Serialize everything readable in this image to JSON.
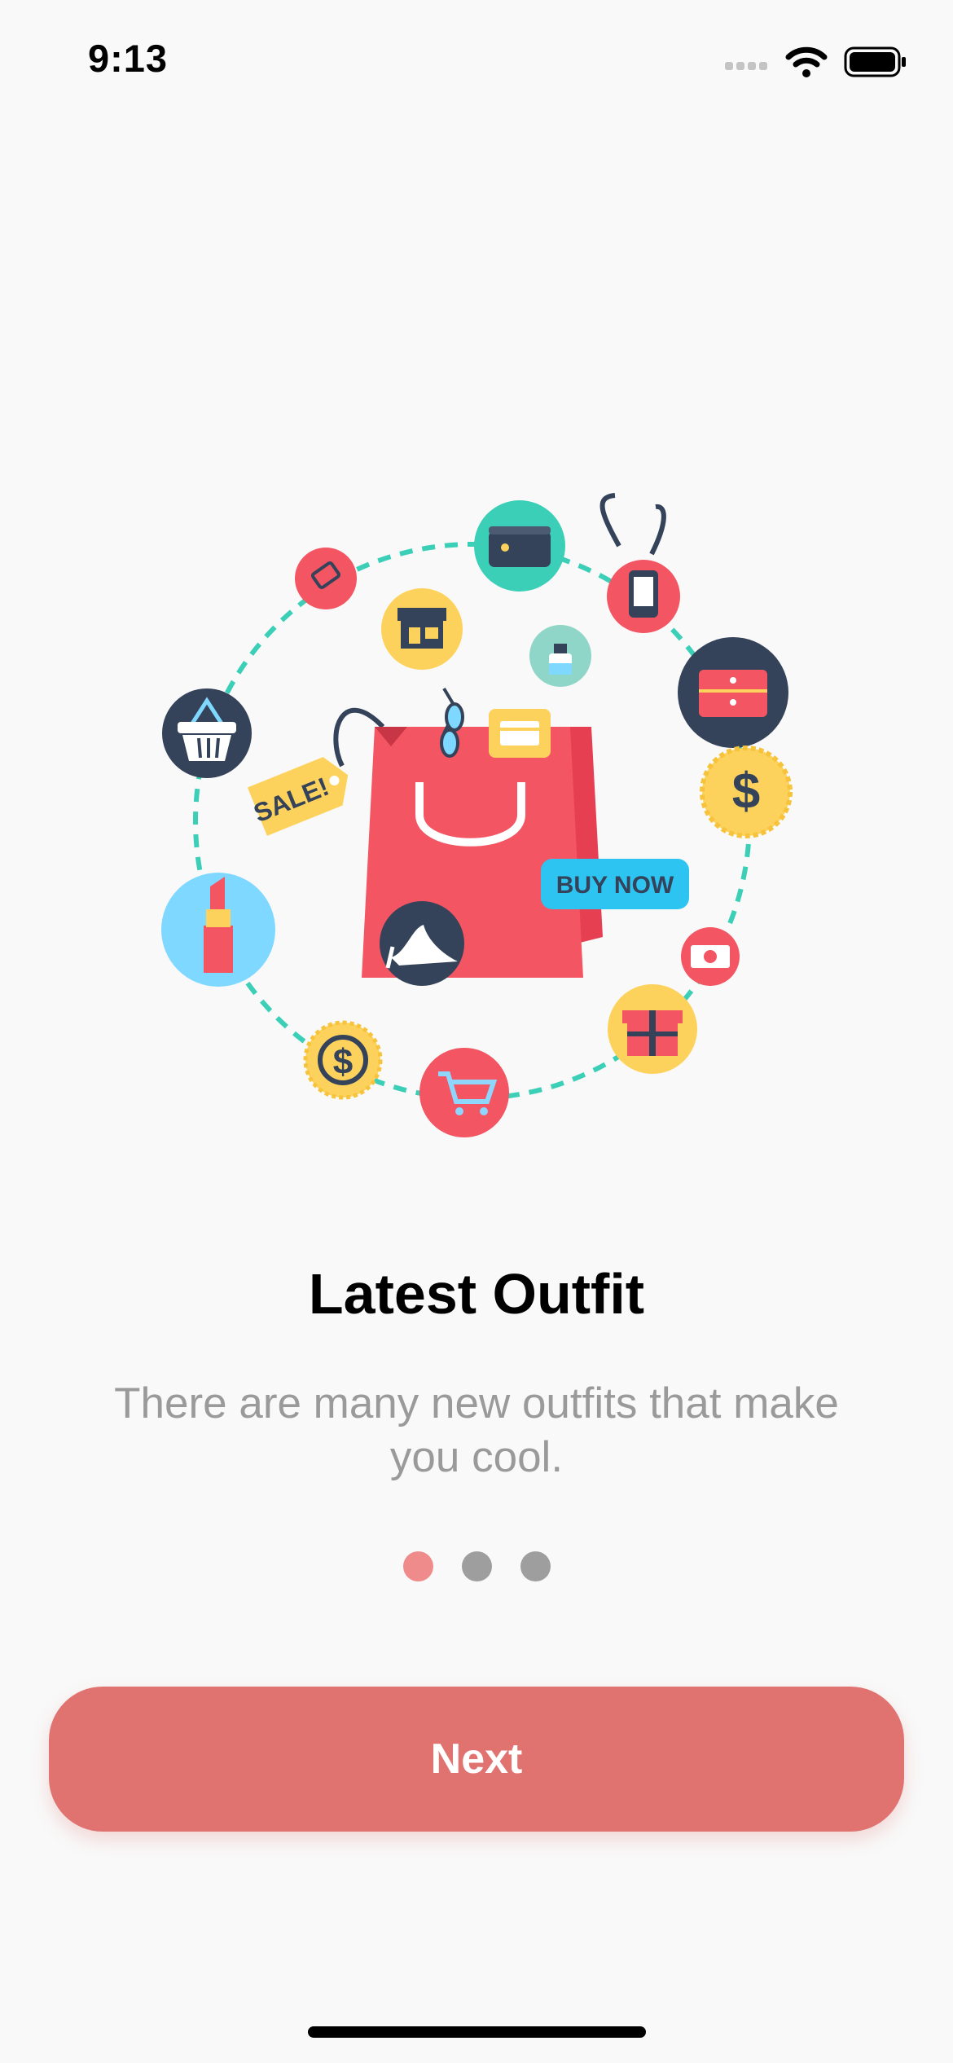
{
  "status_bar": {
    "time": "9:13",
    "icons": [
      "signal-icon",
      "wifi-icon",
      "battery-icon"
    ]
  },
  "illustration": {
    "sale_tag": "SALE!",
    "buy_now_badge": "BUY NOW",
    "icons": [
      "shopping-bag-icon",
      "wallet-icon",
      "phone-icon",
      "drawer-icon",
      "dollar-badge-icon",
      "money-icon",
      "gift-icon",
      "cart-icon",
      "coin-icon",
      "lipstick-icon",
      "basket-icon",
      "card-icon",
      "store-icon",
      "perfume-icon",
      "high-heel-icon",
      "glasses-icon",
      "tag-icon"
    ]
  },
  "onboarding": {
    "title": "Latest Outfit",
    "description": "There are many new outfits that make you cool.",
    "page_index": 1,
    "page_count": 3
  },
  "actions": {
    "next_label": "Next"
  },
  "colors": {
    "accent": "#e07370",
    "dot_active": "#ef8b8b",
    "dot_inactive": "#9e9e9e",
    "bag": "#f35562",
    "teal": "#3ccfb7",
    "navy": "#344359",
    "yellow": "#fdd25c",
    "sky": "#7ed8ff"
  }
}
